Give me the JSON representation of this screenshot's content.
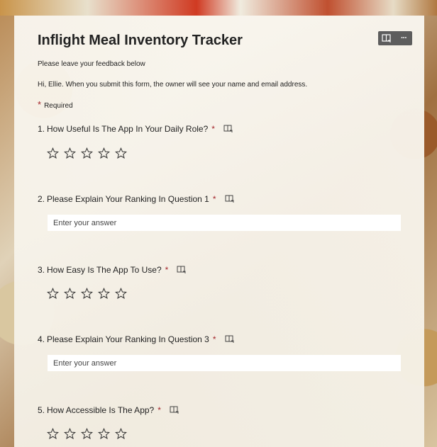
{
  "form": {
    "title": "Inflight Meal Inventory Tracker",
    "subtitle": "Please leave your feedback below",
    "notice": "Hi, Ellie. When you submit this form, the owner will see your name and email address.",
    "required_marker": "*",
    "required_label": "Required"
  },
  "toolbar": {
    "icons": [
      "immersive-reader-icon",
      "more-options-icon"
    ],
    "more_label": "···"
  },
  "questions": [
    {
      "number": "1.",
      "text": "How Useful Is The App In Your Daily Role?",
      "required": "*",
      "type": "rating",
      "stars": 5
    },
    {
      "number": "2.",
      "text": "Please Explain Your Ranking In Question 1",
      "required": "*",
      "type": "text",
      "placeholder": "Enter your answer"
    },
    {
      "number": "3.",
      "text": "How Easy Is The App To Use?",
      "required": "*",
      "type": "rating",
      "stars": 5
    },
    {
      "number": "4.",
      "text": "Please Explain Your Ranking In Question 3",
      "required": "*",
      "type": "text",
      "placeholder": "Enter your answer"
    },
    {
      "number": "5.",
      "text": "How Accessible Is The App?",
      "required": "*",
      "type": "rating",
      "stars": 5
    }
  ]
}
